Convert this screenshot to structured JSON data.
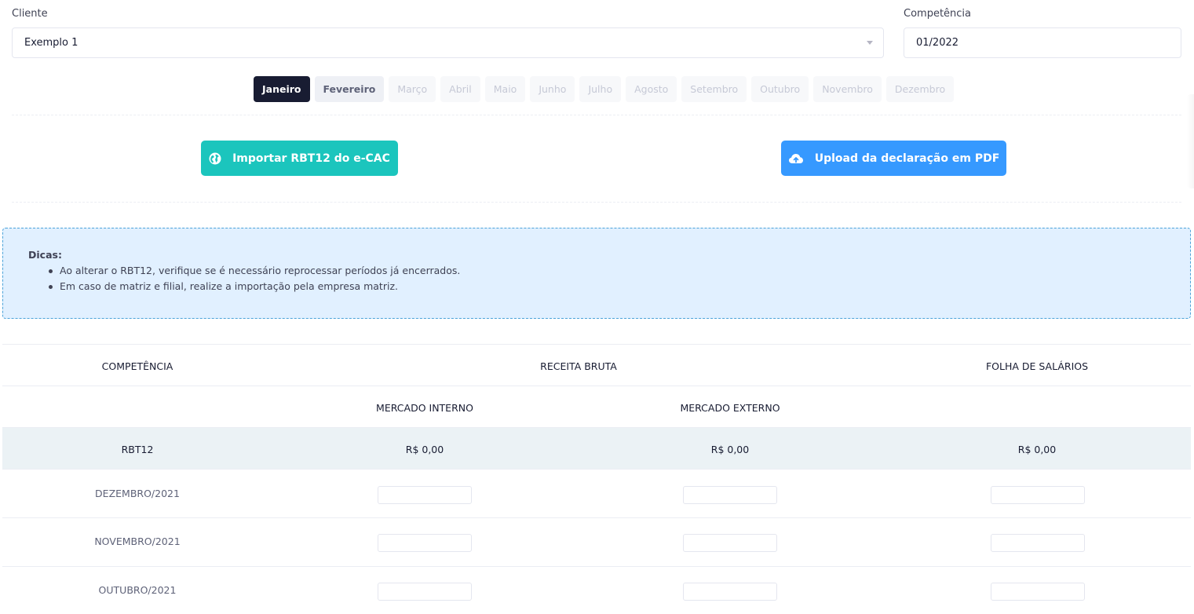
{
  "form": {
    "cliente_label": "Cliente",
    "cliente_value": "Exemplo 1",
    "competencia_label": "Competência",
    "competencia_value": "01/2022"
  },
  "months": [
    "Janeiro",
    "Fevereiro",
    "Março",
    "Abril",
    "Maio",
    "Junho",
    "Julho",
    "Agosto",
    "Setembro",
    "Outubro",
    "Novembro",
    "Dezembro"
  ],
  "selected_month": "Janeiro",
  "actions": {
    "import_label": "Importar RBT12 do e-CAC",
    "upload_label": "Upload da declaração em PDF"
  },
  "tips": {
    "title": "Dicas:",
    "items": [
      "Ao alterar o RBT12, verifique se é necessário reprocessar períodos já encerrados.",
      "Em caso de matriz e filial, realize a importação pela empresa matriz."
    ]
  },
  "table": {
    "headers": {
      "competencia": "COMPETÊNCIA",
      "receita_bruta": "RECEITA BRUTA",
      "folha_salarios": "FOLHA DE SALÁRIOS",
      "mercado_interno": "MERCADO INTERNO",
      "mercado_externo": "MERCADO EXTERNO"
    },
    "rbt12": {
      "label": "RBT12",
      "mercado_interno": "R$ 0,00",
      "mercado_externo": "R$ 0,00",
      "folha": "R$ 0,00"
    },
    "rows": [
      {
        "period": "DEZEMBRO/2021"
      },
      {
        "period": "NOVEMBRO/2021"
      },
      {
        "period": "OUTUBRO/2021"
      }
    ]
  },
  "colors": {
    "teal": "#1bc5bd",
    "blue": "#3699ff",
    "dark": "#181c32",
    "tips_bg": "#e1f0ff"
  }
}
